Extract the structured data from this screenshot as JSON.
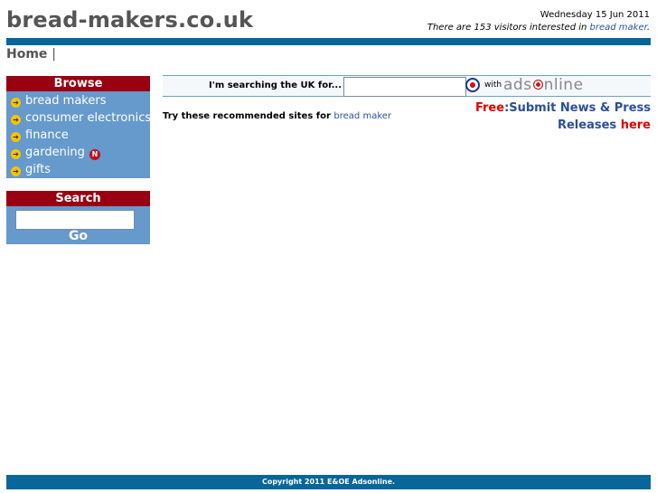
{
  "header": {
    "site_title": "bread-makers.co.uk",
    "date": "Wednesday 15 Jun 2011",
    "visitors_prefix": "There are 153 visitors interested in ",
    "visitors_link": "bread maker",
    "visitors_suffix": "."
  },
  "breadcrumb": {
    "home": "Home",
    "separator": "|"
  },
  "browse": {
    "title": "Browse",
    "items": [
      {
        "label": "bread makers",
        "badge": ""
      },
      {
        "label": "consumer electronics",
        "badge": ""
      },
      {
        "label": "finance",
        "badge": ""
      },
      {
        "label": "gardening",
        "badge": "N"
      },
      {
        "label": "gifts",
        "badge": ""
      }
    ]
  },
  "search_box": {
    "title": "Search",
    "input_value": "",
    "go_label": "Go"
  },
  "search_strip": {
    "label": "I'm searching the UK for...",
    "input_value": "",
    "with_label": "with",
    "logo_text_1": "ads",
    "logo_text_2": "nline"
  },
  "promo": {
    "free": "Free",
    "colon_text": ":Submit News & Press",
    "releases": "Releases",
    "here": "here"
  },
  "recommend": {
    "prefix": "Try these recommended sites for ",
    "link": "bread maker"
  },
  "footer": {
    "copyright": "Copyright 2011 E&OE Adsonline."
  },
  "colors": {
    "header_bar": "#07669a",
    "box_header": "#990011",
    "box_bg": "#6699cc",
    "link": "#2a4fa0",
    "promo_red": "#e00000"
  },
  "icons": {
    "menu_bullet": "arrow-icon",
    "new_badge": "new-badge",
    "flag": "roundel-icon"
  }
}
